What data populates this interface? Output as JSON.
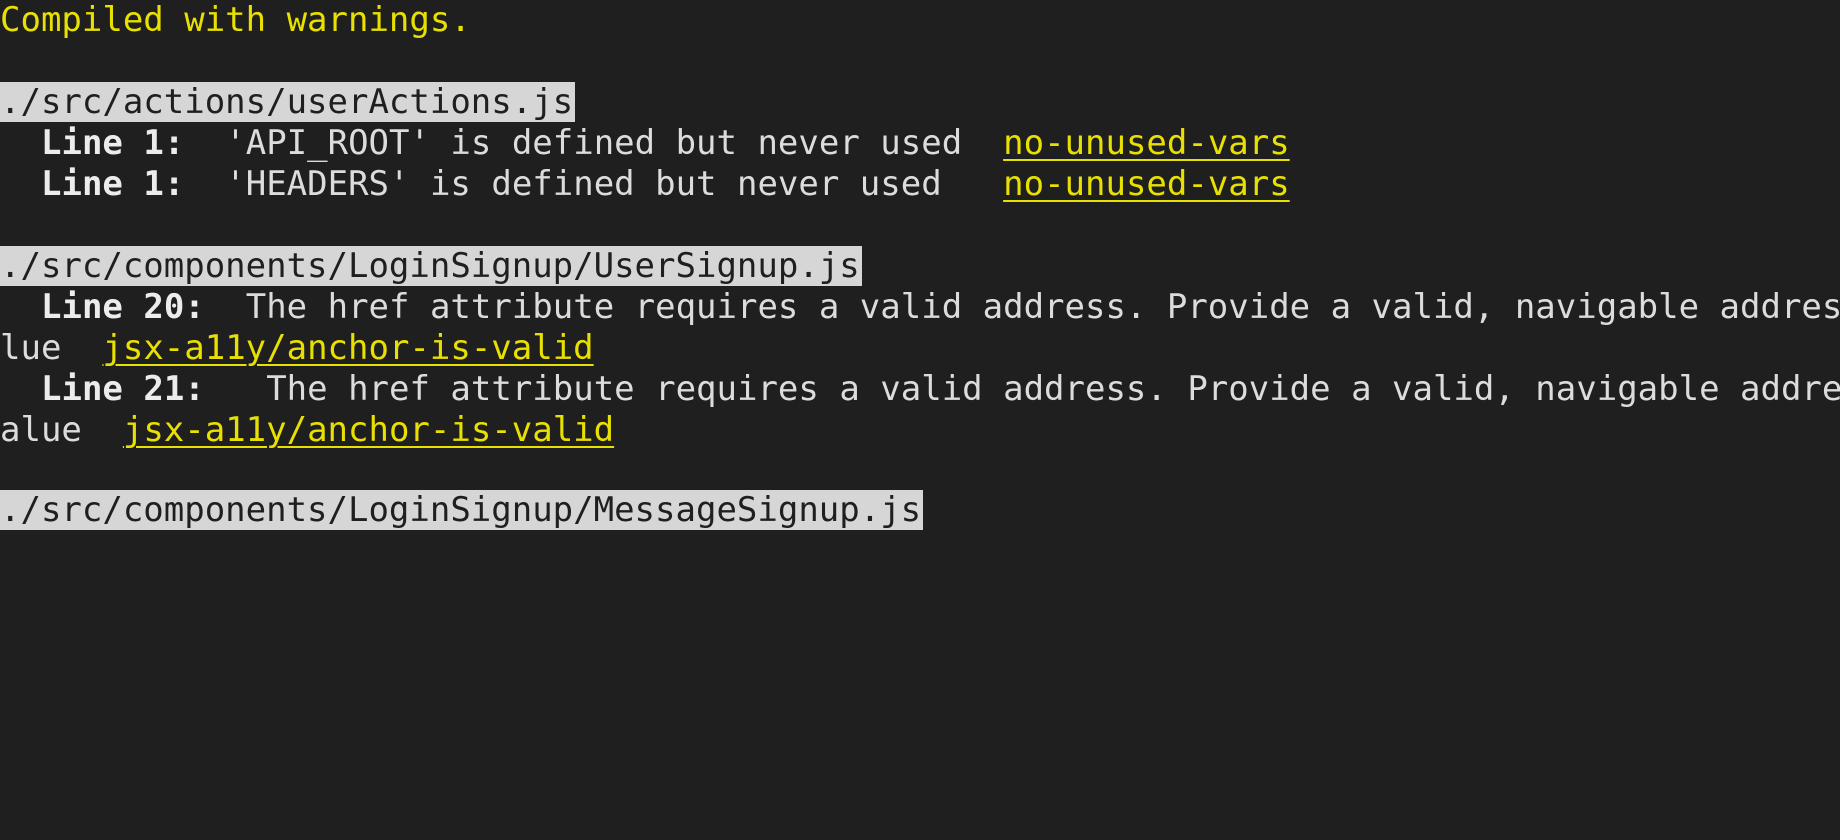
{
  "title": "Compiled with warnings.",
  "files": [
    {
      "path": "./src/actions/userActions.js",
      "warnings": [
        {
          "line": "Line 1:",
          "gap": "  ",
          "message": "'API_ROOT' is defined but never used",
          "pad": "  ",
          "rule": "no-unused-vars"
        },
        {
          "line": "Line 1:",
          "gap": "  ",
          "message": "'HEADERS' is defined but never used",
          "pad": "   ",
          "rule": "no-unused-vars"
        }
      ]
    },
    {
      "path": "./src/components/LoginSignup/UserSignup.js",
      "warnings": [
        {
          "line": "Line 20:",
          "gap": "  ",
          "message": "The href attribute requires a valid address. Provide a valid, navigable address",
          "cont": "lue",
          "pad": "  ",
          "rule": "jsx-a11y/anchor-is-valid"
        },
        {
          "line": "Line 21:",
          "gap": "   ",
          "message": "The href attribute requires a valid address. Provide a valid, navigable address",
          "cont": "alue",
          "pad": "  ",
          "rule": "jsx-a11y/anchor-is-valid"
        }
      ]
    },
    {
      "path": "./src/components/LoginSignup/MessageSignup.js"
    }
  ]
}
